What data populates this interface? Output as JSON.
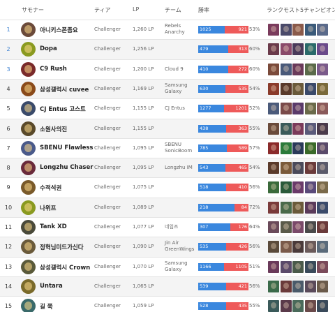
{
  "header": {
    "summoner": "サモナー",
    "tier": "ティア",
    "lp": "LP",
    "team": "チーム",
    "winrate": "勝率",
    "champions": "ランクモスト5チャンピオン"
  },
  "rows": [
    {
      "rank": "1",
      "name": "아니키스폰좀요",
      "tier": "Challenger",
      "lp": "1,260 LP",
      "team1": "Rebels",
      "team2": "Anarchy",
      "wins": "1025",
      "losses": "921",
      "pct": "53%",
      "w": 53,
      "rank_blue": true,
      "avatar": "#6b4a3a",
      "champs": [
        "#7a3b5c",
        "#4a4a6a",
        "#8a5a4a",
        "#3a5a7a",
        "#5a6a8a"
      ]
    },
    {
      "rank": "2",
      "name": "Dopa",
      "tier": "Challenger",
      "lp": "1,256 LP",
      "team1": "",
      "team2": "",
      "wins": "479",
      "losses": "313",
      "pct": "60%",
      "w": 60,
      "rank_blue": true,
      "avatar": "#8a9a20",
      "champs": [
        "#6a3a4a",
        "#8a4a6a",
        "#4a3a5a",
        "#2a6a6a",
        "#6a4a8a"
      ]
    },
    {
      "rank": "3",
      "name": "C9 Rush",
      "tier": "Challenger",
      "lp": "1,200 LP",
      "team1": "Cloud 9",
      "team2": "",
      "wins": "410",
      "losses": "272",
      "pct": "60%",
      "w": 60,
      "rank_blue": true,
      "avatar": "#7a2a2a",
      "champs": [
        "#7a4a3a",
        "#4a5a7a",
        "#6a3a5a",
        "#5a6a4a",
        "#7a5a8a"
      ]
    },
    {
      "rank": "4",
      "name": "삼성갤럭시 cuvee",
      "tier": "Challenger",
      "lp": "1,169 LP",
      "team1": "Samsung",
      "team2": "Galaxy",
      "wins": "630",
      "losses": "535",
      "pct": "54%",
      "w": 54,
      "rank_blue": false,
      "avatar": "#8a4a1a",
      "champs": [
        "#8a3a2a",
        "#5a3a2a",
        "#6a5a3a",
        "#3a4a6a",
        "#7a6a3a"
      ]
    },
    {
      "rank": "5",
      "name": "CJ Entus 고스트",
      "tier": "Challenger",
      "lp": "1,155 LP",
      "team1": "CJ Entus",
      "team2": "",
      "wins": "1277",
      "losses": "1201",
      "pct": "52%",
      "w": 52,
      "rank_blue": false,
      "avatar": "#3a4a6a",
      "champs": [
        "#4a5a7a",
        "#7a4a4a",
        "#5a3a6a",
        "#6a6a4a",
        "#8a5a5a"
      ]
    },
    {
      "rank": "6",
      "name": "소원사의진",
      "tier": "Challenger",
      "lp": "1,155 LP",
      "team1": "",
      "team2": "",
      "wins": "438",
      "losses": "363",
      "pct": "55%",
      "w": 55,
      "rank_blue": false,
      "avatar": "#5a4a2a",
      "champs": [
        "#6a4a3a",
        "#3a5a5a",
        "#7a3a5a",
        "#5a5a7a",
        "#4a3a4a"
      ]
    },
    {
      "rank": "7",
      "name": "SBENU Flawless",
      "tier": "Challenger",
      "lp": "1,095 LP",
      "team1": "SBENU",
      "team2": "SonicBoom",
      "wins": "785",
      "losses": "589",
      "pct": "57%",
      "w": 57,
      "rank_blue": false,
      "avatar": "#4a5a8a",
      "champs": [
        "#8a2a2a",
        "#2a7a3a",
        "#2a3a5a",
        "#3a6a2a",
        "#5a4a6a"
      ]
    },
    {
      "rank": "8",
      "name": "Longzhu Chaser",
      "tier": "Challenger",
      "lp": "1,095 LP",
      "team1": "Longzhu IM",
      "team2": "",
      "wins": "543",
      "losses": "465",
      "pct": "54%",
      "w": 54,
      "rank_blue": false,
      "avatar": "#6a2a3a",
      "champs": [
        "#5a3a2a",
        "#7a5a3a",
        "#4a4a5a",
        "#6a3a3a",
        "#5a5a6a"
      ]
    },
    {
      "rank": "9",
      "name": "수적석권",
      "tier": "Challenger",
      "lp": "1,075 LP",
      "team1": "",
      "team2": "",
      "wins": "518",
      "losses": "410",
      "pct": "56%",
      "w": 56,
      "rank_blue": false,
      "avatar": "#7a5a2a",
      "champs": [
        "#3a6a3a",
        "#2a5a3a",
        "#6a3a6a",
        "#5a4a7a",
        "#7a6a4a"
      ]
    },
    {
      "rank": "10",
      "name": "나위프",
      "tier": "Challenger",
      "lp": "1,089 LP",
      "team1": "",
      "team2": "",
      "wins": "218",
      "losses": "84",
      "pct": "72%",
      "w": 72,
      "rank_blue": false,
      "avatar": "#8a9a20",
      "champs": [
        "#7a3a3a",
        "#4a6a4a",
        "#6a5a3a",
        "#5a3a5a",
        "#3a4a6a"
      ]
    },
    {
      "rank": "11",
      "name": "Tank XD",
      "tier": "Challenger",
      "lp": "1,077 LP",
      "team1": "네임즈",
      "team2": "",
      "wins": "307",
      "losses": "176",
      "pct": "64%",
      "w": 64,
      "rank_blue": false,
      "avatar": "#4a4a3a",
      "champs": [
        "#6a4a5a",
        "#5a5a4a",
        "#7a4a6a",
        "#4a4a4a",
        "#6a3a3a"
      ]
    },
    {
      "rank": "12",
      "name": "정혁님미드가신다",
      "tier": "Challenger",
      "lp": "1,090 LP",
      "team1": "Jin Air",
      "team2": "GreenWings",
      "wins": "535",
      "losses": "426",
      "pct": "56%",
      "w": 56,
      "rank_blue": false,
      "avatar": "#6a5a3a",
      "champs": [
        "#5a4a3a",
        "#7a5a4a",
        "#4a3a3a",
        "#6a5a5a",
        "#5a6a7a"
      ]
    },
    {
      "rank": "13",
      "name": "삼성갤럭시 Crown",
      "tier": "Challenger",
      "lp": "1,070 LP",
      "team1": "Samsung",
      "team2": "Galaxy",
      "wins": "1166",
      "losses": "1105",
      "pct": "51%",
      "w": 51,
      "rank_blue": false,
      "avatar": "#5a5a3a",
      "champs": [
        "#6a3a5a",
        "#5a4a6a",
        "#4a5a4a",
        "#3a4a5a",
        "#7a4a5a"
      ]
    },
    {
      "rank": "14",
      "name": "Untara",
      "tier": "Challenger",
      "lp": "1,065 LP",
      "team1": "",
      "team2": "",
      "wins": "539",
      "losses": "421",
      "pct": "56%",
      "w": 56,
      "rank_blue": false,
      "avatar": "#7a6a2a",
      "champs": [
        "#3a6a4a",
        "#6a3a3a",
        "#4a5a6a",
        "#5a4a5a",
        "#6a5a4a"
      ]
    },
    {
      "rank": "15",
      "name": "길 쭉",
      "tier": "Challenger",
      "lp": "1,059 LP",
      "team1": "",
      "team2": "",
      "wins": "528",
      "losses": "435",
      "pct": "55%",
      "w": 55,
      "rank_blue": false,
      "avatar": "#3a6a6a",
      "champs": [
        "#3a5a5a",
        "#5a3a4a",
        "#4a6a5a",
        "#6a4a4a",
        "#3a4a5a"
      ]
    }
  ]
}
